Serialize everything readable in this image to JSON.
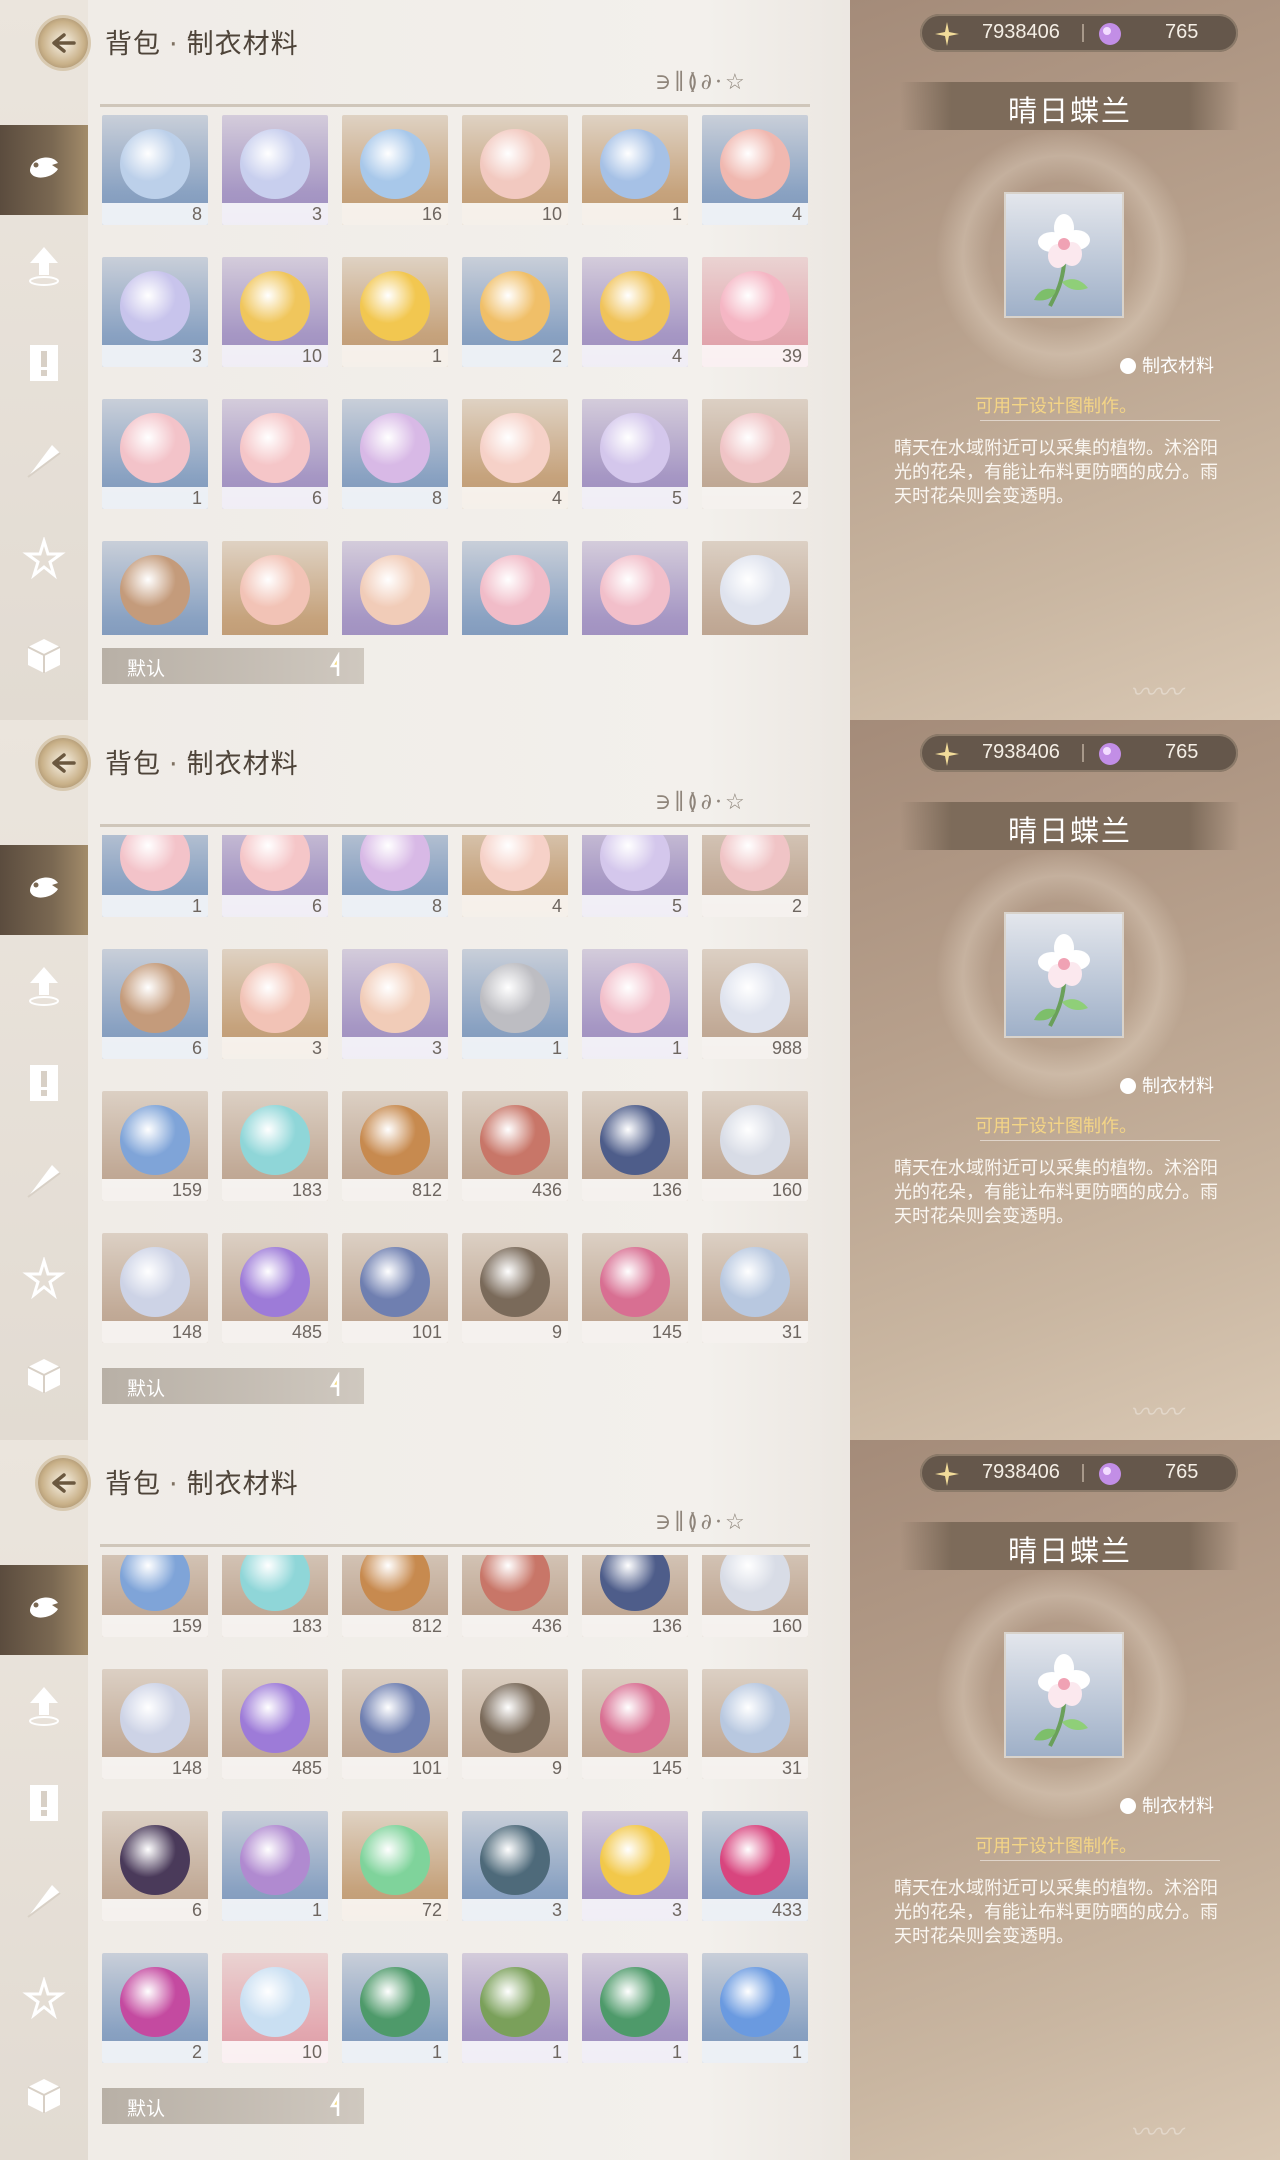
{
  "header": {
    "breadcrumb_main": "背包",
    "breadcrumb_separator": "·",
    "breadcrumb_sub": "制衣材料",
    "rune_text": "∋∥≬∂·☆"
  },
  "currency": {
    "gold": "7938406",
    "gems": "765"
  },
  "detail": {
    "name": "晴日蝶兰",
    "category": "制衣材料",
    "usage": "可用于设计图制作。",
    "description": "晴天在水域附近可以采集的植物。沐浴阳光的花朵，有能让布料更防晒的成分。雨天时花朵则会变透明。"
  },
  "sort": {
    "label": "默认"
  },
  "tabs": [
    "fish-tab",
    "upgrade-tab",
    "quest-tab",
    "feather-tab",
    "star-tab",
    "box-tab"
  ],
  "panels": [
    {
      "active_tab": 0,
      "rows": [
        [
          {
            "c": "blue",
            "orb": "#bcd0ea",
            "n": "8"
          },
          {
            "c": "purple",
            "orb": "#c8cfee",
            "n": "3"
          },
          {
            "c": "gold",
            "orb": "#a8c8ea",
            "n": "16"
          },
          {
            "c": "gold",
            "orb": "#f2c9c0",
            "n": "10"
          },
          {
            "c": "gold",
            "orb": "#a6c1e6",
            "n": "1"
          },
          {
            "c": "blue",
            "orb": "#f0b8b0",
            "n": "4"
          }
        ],
        [
          {
            "c": "blue",
            "orb": "#c8c4ec",
            "n": "3"
          },
          {
            "c": "purple",
            "orb": "#f0c65c",
            "n": "10"
          },
          {
            "c": "gold",
            "orb": "#f2c750",
            "n": "1"
          },
          {
            "c": "blue",
            "orb": "#f0bf68",
            "n": "2"
          },
          {
            "c": "purple",
            "orb": "#f0c35a",
            "n": "4"
          },
          {
            "c": "pink",
            "orb": "#f5b6c4",
            "n": "39"
          }
        ],
        [
          {
            "c": "blue",
            "orb": "#f3c3c9",
            "n": "1"
          },
          {
            "c": "purple",
            "orb": "#f5c6c8",
            "n": "6"
          },
          {
            "c": "blue",
            "orb": "#d8b9e6",
            "n": "8"
          },
          {
            "c": "gold",
            "orb": "#f6d1c8",
            "n": "4"
          },
          {
            "c": "purple",
            "orb": "#d4c7ec",
            "n": "5"
          },
          {
            "c": "brown",
            "orb": "#f0c4c6",
            "n": "2"
          }
        ],
        [
          {
            "c": "blue",
            "orb": "#c49b7b",
            "n": ""
          },
          {
            "c": "gold",
            "orb": "#f2c3b6",
            "n": ""
          },
          {
            "c": "purple",
            "orb": "#f1ccb8",
            "n": ""
          },
          {
            "c": "blue",
            "orb": "#f1bcc8",
            "n": ""
          },
          {
            "c": "purple",
            "orb": "#f2bfca",
            "n": ""
          },
          {
            "c": "brown",
            "orb": "#dfe3ee",
            "n": ""
          }
        ]
      ]
    },
    {
      "active_tab": 0,
      "rows": [
        [
          {
            "c": "blue",
            "orb": "#f3c3c9",
            "n": "1"
          },
          {
            "c": "purple",
            "orb": "#f5c6c8",
            "n": "6"
          },
          {
            "c": "blue",
            "orb": "#d8b9e6",
            "n": "8"
          },
          {
            "c": "gold",
            "orb": "#f6d1c8",
            "n": "4"
          },
          {
            "c": "purple",
            "orb": "#d4c7ec",
            "n": "5"
          },
          {
            "c": "brown",
            "orb": "#f0c4c6",
            "n": "2"
          }
        ],
        [
          {
            "c": "blue",
            "orb": "#c49b7b",
            "n": "6"
          },
          {
            "c": "gold",
            "orb": "#f2c3b6",
            "n": "3"
          },
          {
            "c": "purple",
            "orb": "#f1ccb8",
            "n": "3"
          },
          {
            "c": "blue",
            "orb": "#bdbdc2",
            "n": "1"
          },
          {
            "c": "purple",
            "orb": "#f2bfca",
            "n": "1"
          },
          {
            "c": "brown",
            "orb": "#dfe3ee",
            "n": "988"
          }
        ],
        [
          {
            "c": "brown",
            "orb": "#7fa4d8",
            "n": "159"
          },
          {
            "c": "brown",
            "orb": "#8fd6d8",
            "n": "183"
          },
          {
            "c": "brown",
            "orb": "#c78a4f",
            "n": "812"
          },
          {
            "c": "brown",
            "orb": "#c87668",
            "n": "436"
          },
          {
            "c": "brown",
            "orb": "#4e5d8a",
            "n": "136"
          },
          {
            "c": "brown",
            "orb": "#d8dce6",
            "n": "160"
          }
        ],
        [
          {
            "c": "brown",
            "orb": "#cdd3e6",
            "n": "148"
          },
          {
            "c": "brown",
            "orb": "#9d7bd8",
            "n": "485"
          },
          {
            "c": "brown",
            "orb": "#6f7fb0",
            "n": "101"
          },
          {
            "c": "brown",
            "orb": "#7a6a5a",
            "n": "9"
          },
          {
            "c": "brown",
            "orb": "#d86f92",
            "n": "145"
          },
          {
            "c": "brown",
            "orb": "#b8c8e0",
            "n": "31"
          }
        ]
      ]
    },
    {
      "active_tab": 0,
      "rows": [
        [
          {
            "c": "brown",
            "orb": "#7fa4d8",
            "n": "159"
          },
          {
            "c": "brown",
            "orb": "#8fd6d8",
            "n": "183"
          },
          {
            "c": "brown",
            "orb": "#c78a4f",
            "n": "812"
          },
          {
            "c": "brown",
            "orb": "#c87668",
            "n": "436"
          },
          {
            "c": "brown",
            "orb": "#4e5d8a",
            "n": "136"
          },
          {
            "c": "brown",
            "orb": "#d8dce6",
            "n": "160"
          }
        ],
        [
          {
            "c": "brown",
            "orb": "#cdd3e6",
            "n": "148"
          },
          {
            "c": "brown",
            "orb": "#9d7bd8",
            "n": "485"
          },
          {
            "c": "brown",
            "orb": "#6f7fb0",
            "n": "101"
          },
          {
            "c": "brown",
            "orb": "#7a6a5a",
            "n": "9"
          },
          {
            "c": "brown",
            "orb": "#d86f92",
            "n": "145"
          },
          {
            "c": "brown",
            "orb": "#b8c8e0",
            "n": "31"
          }
        ],
        [
          {
            "c": "brown",
            "orb": "#4a3a5a",
            "n": "6"
          },
          {
            "c": "blue",
            "orb": "#b08ad0",
            "n": "1"
          },
          {
            "c": "gold",
            "orb": "#7fd39b",
            "n": "72"
          },
          {
            "c": "blue",
            "orb": "#4e6a7a",
            "n": "3"
          },
          {
            "c": "purple",
            "orb": "#f2c84a",
            "n": "3"
          },
          {
            "c": "blue",
            "orb": "#d8457e",
            "n": "433"
          }
        ],
        [
          {
            "c": "blue",
            "orb": "#c44aa0",
            "n": "2"
          },
          {
            "c": "pink",
            "orb": "#c9dff2",
            "n": "10"
          },
          {
            "c": "blue",
            "orb": "#4e9a6a",
            "n": "1"
          },
          {
            "c": "purple",
            "orb": "#7aa05a",
            "n": "1"
          },
          {
            "c": "purple",
            "orb": "#4e9a6a",
            "n": "1"
          },
          {
            "c": "blue",
            "orb": "#6a9ae0",
            "n": "1"
          }
        ]
      ]
    }
  ]
}
